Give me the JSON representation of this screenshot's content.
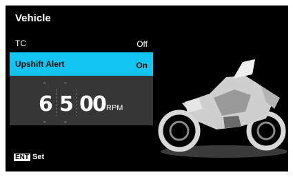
{
  "header": {
    "title": "Vehicle"
  },
  "menu": {
    "tc": {
      "label": "TC",
      "value": "Off"
    },
    "upshift_alert": {
      "label": "Upshift Alert",
      "value": "On"
    }
  },
  "rpm_setting": {
    "digits": [
      "6",
      "5",
      "0",
      "0"
    ],
    "unit": "RPM"
  },
  "footer": {
    "key": "ENT",
    "action": "Set"
  },
  "colors": {
    "accent": "#12c5f0",
    "panel": "#363636",
    "background": "#000000"
  }
}
